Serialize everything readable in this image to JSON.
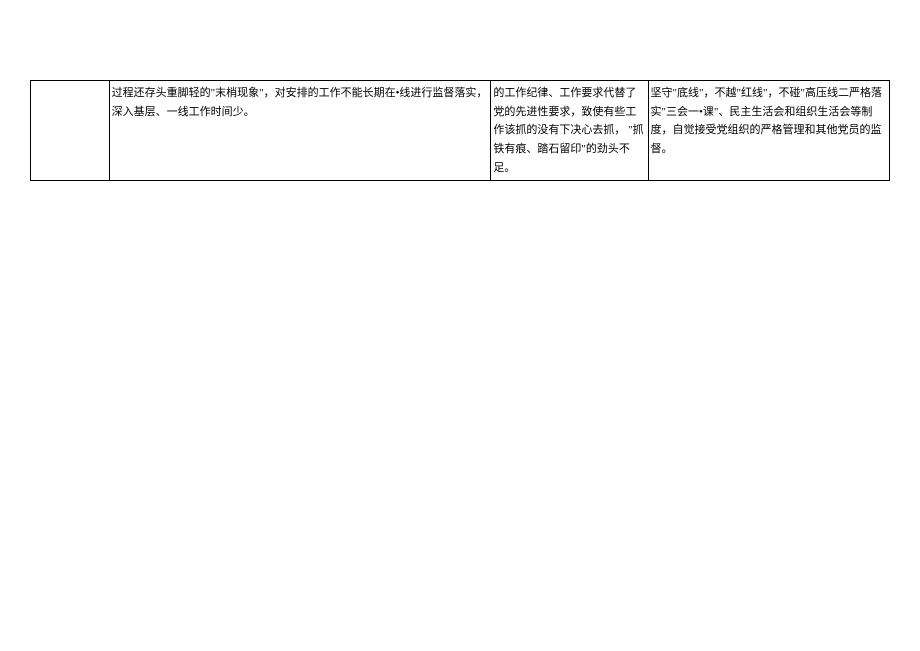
{
  "table": {
    "row": {
      "col1": "",
      "col2": "过程还存头重脚轻的\"末梢现象\"，对安排的工作不能长期在•线进行监督落实，深入基层、一线工作时间少。",
      "col3": "的工作纪律、工作要求代替了党的先进性要求，致使有些工作该抓的没有下决心去抓， \"抓铁有痕、踏石留印\"的劲头不足。",
      "col4": "坚守\"底线\"，不越\"红线\"，不碰\"高压线二严格落实\"三会一•课\"、民主生活会和组织生活会等制度，自觉接受党组织的严格管理和其他党员的监督。"
    }
  }
}
